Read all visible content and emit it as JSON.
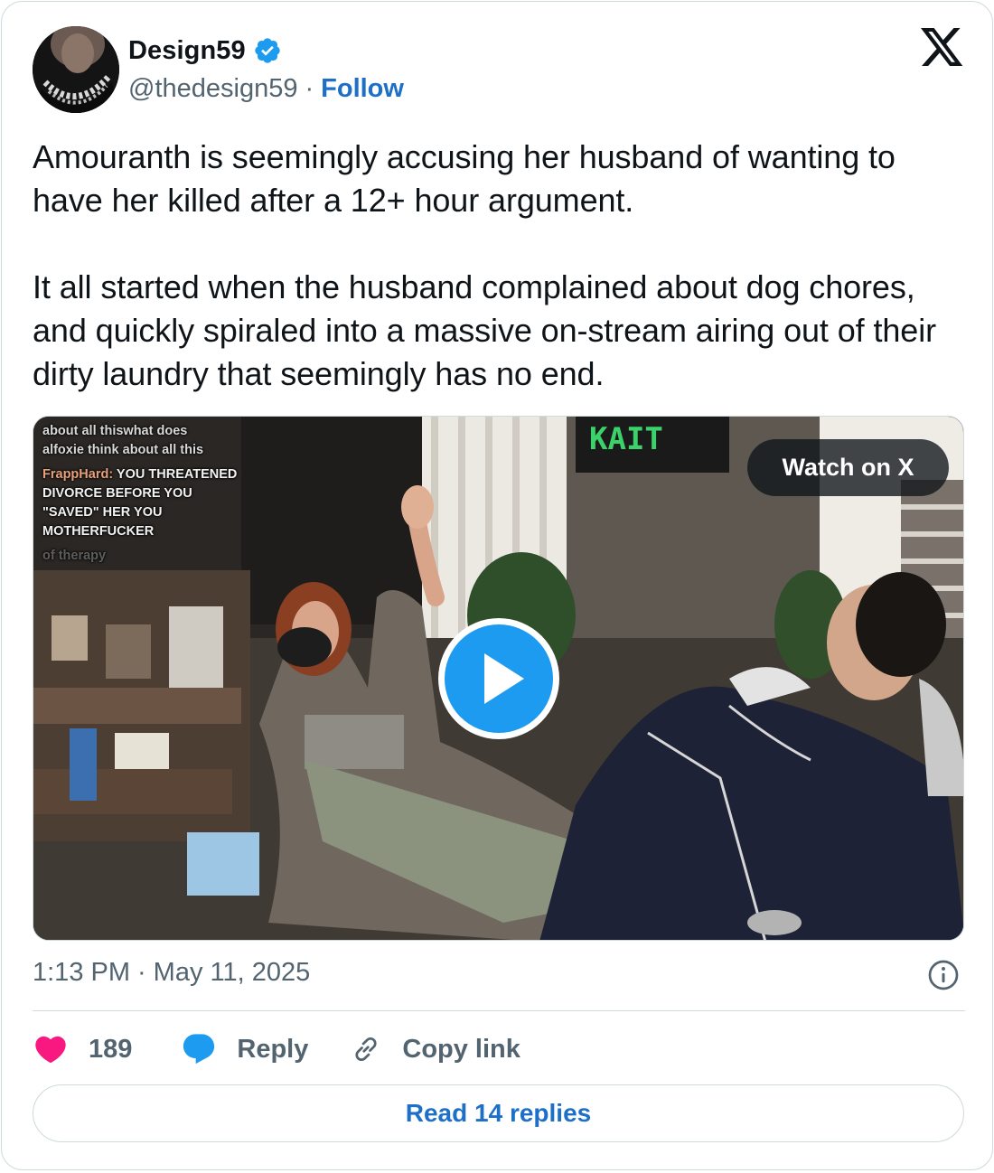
{
  "author": {
    "display_name": "Design59",
    "handle": "@thedesign59",
    "separator": "·",
    "follow_label": "Follow",
    "verified": true
  },
  "tweet": {
    "text": "Amouranth is seemingly accusing her husband of wanting to have her killed after a 12+ hour argument.\n\nIt all started when the husband complained about dog chores, and quickly spiraled into a massive on-stream airing out of their dirty laundry that seemingly has no end."
  },
  "media": {
    "watch_label": "Watch on X",
    "overlay_chat": {
      "line1": "about all thiswhat does",
      "line2": "alfoxie think about all this",
      "user": "FrappHard:",
      "message_first": " YOU",
      "message_rest": "THREATENED DIVORCE BEFORE YOU \"SAVED\" HER YOU MOTHERFUCKER",
      "faint": "of therapy"
    },
    "banner_text": "KAIT"
  },
  "meta": {
    "time": "1:13 PM",
    "separator": "·",
    "date": "May 11, 2025"
  },
  "actions": {
    "like_count": "189",
    "reply_label": "Reply",
    "copy_label": "Copy link",
    "read_replies_label": "Read 14 replies"
  },
  "colors": {
    "like": "#f91880",
    "reply": "#1d9bf0",
    "link": "#1d6fc8",
    "muted": "#536471",
    "border": "#cfd9de"
  },
  "icons": {
    "verified": "verified-badge-icon",
    "logo": "x-logo-icon",
    "play": "play-icon",
    "info": "info-icon",
    "like": "heart-icon",
    "reply": "speech-bubble-icon",
    "copy": "link-icon"
  }
}
